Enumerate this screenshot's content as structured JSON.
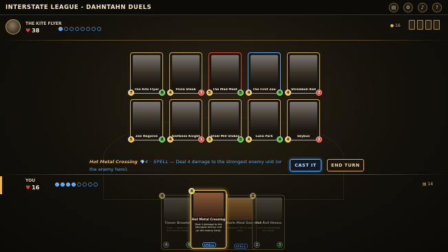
{
  "header": {
    "title": "INTERSTATE LEAGUE - DAHNTAHN DUELS",
    "buttons": [
      {
        "name": "deck-icon",
        "glyph": "▤"
      },
      {
        "name": "gear-icon",
        "glyph": "⚙"
      },
      {
        "name": "sound-icon",
        "glyph": "♪"
      },
      {
        "name": "help-icon",
        "glyph": "?"
      }
    ]
  },
  "opponent": {
    "name": "THE KITE FLYER",
    "hp": "38",
    "heart": "♥",
    "pips_filled": 1,
    "pips_total": 8,
    "deck_count": "16",
    "deck_icon": "coin-icon"
  },
  "player": {
    "name": "YOU",
    "hp": "16",
    "heart": "♥",
    "pips_filled": 4,
    "pips_total": 8,
    "deck_count": "14",
    "deck_icon": "deck-icon"
  },
  "enemy_board": [
    {
      "name": "The Kite Flyer",
      "atk": "7",
      "hp": "8",
      "hp_color": "green",
      "frame": "#c8a860"
    },
    {
      "name": "Pizza Steak",
      "atk": "4",
      "hp": "3",
      "hp_color": "red",
      "frame": "#c8a860"
    },
    {
      "name": "The Mad Meat",
      "atk": "5",
      "hp": "5",
      "hp_color": "green",
      "frame": "#d8443a"
    },
    {
      "name": "The First Zoo",
      "atk": "4",
      "hp": "4",
      "hp_color": "green",
      "frame": "#5aa8f0"
    },
    {
      "name": "Stromboli Roll",
      "atk": "4",
      "hp": "2",
      "hp_color": "red",
      "frame": "#c8a860"
    }
  ],
  "player_board": [
    {
      "name": "Zee Nagaree",
      "atk": "5",
      "hp": "8",
      "hp_color": "green",
      "frame": "#c8a860"
    },
    {
      "name": "Glotbees Knight",
      "atk": "4",
      "hp": "1",
      "hp_color": "red",
      "frame": "#c8a860"
    },
    {
      "name": "Steel Mill Stoker",
      "atk": "3",
      "hp": "5",
      "hp_color": "green",
      "frame": "#c8a860"
    },
    {
      "name": "Luna Park",
      "atk": "4",
      "hp": "4",
      "hp_color": "green",
      "frame": "#c8a860"
    },
    {
      "name": "Skybus",
      "atk": "4",
      "hp": "2",
      "hp_color": "red",
      "frame": "#c8a860"
    }
  ],
  "spell_preview": {
    "name": "Hot Metal Crossing",
    "gem": "💎",
    "type": "4 · SPELL",
    "text": "— Deal 4 damage to the strongest enemy unit (or the enemy hero)."
  },
  "actions": {
    "cast": "CAST IT",
    "end_turn": "END TURN"
  },
  "hand": [
    {
      "name": "Tinner Brawler",
      "cost": "4",
      "desc": "Rush — deals the first enemy hands",
      "atk": "4",
      "hp": "3",
      "state": "dim"
    },
    {
      "name": "Hot Metal Crossing",
      "cost": "4",
      "desc": "Deal 4 damage to the strongest enemy unit (or the enemy hero).",
      "tag": "SPELL",
      "state": "selected"
    },
    {
      "name": "Whole-Meal Sammich",
      "cost": "3",
      "desc": "Restore 6 HP to your hero.",
      "tag": "SPELL",
      "state": "dim"
    },
    {
      "name": "Hot Roll Henna",
      "cost": "2",
      "desc": "Can't be destroyed by hands",
      "atk": "2",
      "hp": "3",
      "state": "dim"
    }
  ]
}
